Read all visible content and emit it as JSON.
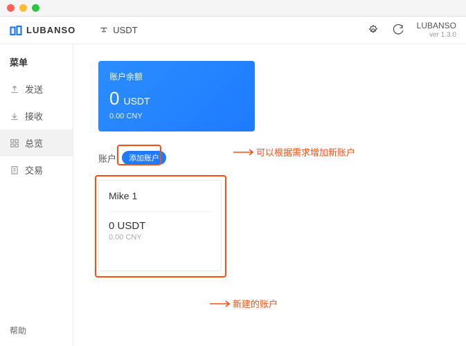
{
  "header": {
    "brand": "LUBANSO",
    "currency": "USDT",
    "version_name": "LUBANSO",
    "version_num": "ver 1.3.0"
  },
  "sidebar": {
    "title": "菜单",
    "items": [
      {
        "label": "发送"
      },
      {
        "label": "接收"
      },
      {
        "label": "总览"
      },
      {
        "label": "交易"
      }
    ],
    "help": "帮助"
  },
  "balance": {
    "title": "账户余额",
    "amount": "0",
    "unit": "USDT",
    "fiat": "0.00 CNY"
  },
  "accounts": {
    "label": "账户",
    "add_button": "添加账户",
    "list": [
      {
        "name": "Mike 1",
        "balance": "0 USDT",
        "fiat": "0.00 CNY"
      }
    ]
  },
  "annotations": {
    "add_hint": "可以根据需求增加新账户",
    "new_hint": "新建的账户"
  }
}
